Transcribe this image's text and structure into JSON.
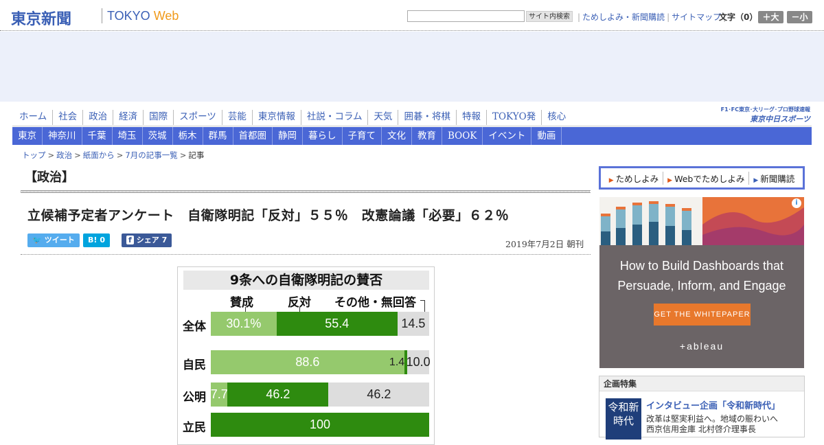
{
  "header": {
    "logo": "東京新聞",
    "logo_en_1": "TOKYO ",
    "logo_en_2": "Web",
    "search_button": "サイト内検索",
    "links": [
      "ためしよみ・新聞購読",
      "サイトマップ"
    ],
    "font_label": "文字（0）",
    "font_larger": "＋大",
    "font_smaller": "－小"
  },
  "nav_main": [
    "ホーム",
    "社会",
    "政治",
    "経済",
    "国際",
    "スポーツ",
    "芸能",
    "東京情報",
    "社説・コラム",
    "天気",
    "囲碁・将棋",
    "特報",
    "TOKYO発",
    "核心"
  ],
  "sports_logo": {
    "top": "F1･FC東京･大リーグ･プロ野球速報",
    "name": "東京中日スポーツ"
  },
  "nav_sub": [
    "東京",
    "神奈川",
    "千葉",
    "埼玉",
    "茨城",
    "栃木",
    "群馬",
    "首都圏",
    "静岡",
    "暮らし",
    "子育て",
    "文化",
    "教育",
    "BOOK",
    "イベント",
    "動画"
  ],
  "breadcrumb": [
    "トップ",
    "政治",
    "紙面から",
    "7月の記事一覧",
    "記事"
  ],
  "breadcrumb_sep": ">",
  "article": {
    "section": "【政治】",
    "headline": "立候補予定者アンケート　自衛隊明記「反対」５５％　改憲論議「必要」６２％",
    "date": "2019年7月2日 朝刊",
    "share": {
      "tweet": "ツイート",
      "hatena_icon": "B!",
      "hatena_count": "0",
      "fb_icon": "f",
      "fb_label": "シェア",
      "fb_count": "7"
    }
  },
  "figure": {
    "title": "9条への自衛隊明記の賛否",
    "legend": [
      "賛成",
      "反対",
      "その他・無回答"
    ],
    "rows": [
      {
        "label": "全体",
        "segments": [
          "30.1%",
          "55.4",
          "14.5"
        ]
      },
      {
        "label": "自民",
        "segments": [
          "88.6",
          "1.4",
          "10.0"
        ]
      },
      {
        "label": "公明",
        "segments": [
          "7.7",
          "46.2",
          "46.2"
        ]
      },
      {
        "label": "立民",
        "segments": [
          "100"
        ]
      }
    ]
  },
  "chart_data": {
    "type": "bar",
    "title": "9条への自衛隊明記の賛否",
    "categories": [
      "全体",
      "自民",
      "公明",
      "立民"
    ],
    "series": [
      {
        "name": "賛成",
        "values": [
          30.1,
          88.6,
          7.7,
          0
        ]
      },
      {
        "name": "反対",
        "values": [
          55.4,
          1.4,
          46.2,
          100
        ]
      },
      {
        "name": "その他・無回答",
        "values": [
          14.5,
          10.0,
          46.2,
          0
        ]
      }
    ],
    "stacked": true,
    "orientation": "horizontal",
    "colors": {
      "賛成": "#95c96d",
      "反対": "#2e8b0f",
      "その他・無回答": "#dddddd"
    }
  },
  "sidebar": {
    "links": [
      "ためしよみ",
      "Webでためしよみ",
      "新聞購読"
    ],
    "ad": {
      "headline": "How to Build Dashboards that Persuade, Inform, and Engage",
      "cta": "GET THE WHITEPAPER",
      "brand": "+ableau",
      "info_icon": "i"
    },
    "feature": {
      "header": "企画特集",
      "image_text": "令和新時代",
      "title": "インタビュー企画「令和新時代」",
      "subtitle_1": "改革は堅実利益へ。地域の賑わいへ",
      "subtitle_2": "西京信用金庫 北村啓介理事長"
    }
  },
  "colors": {
    "brand_blue": "#3a5fb5",
    "nav_bar": "#4a67d6",
    "ad_band": "#ecf0fa",
    "bar_light": "#95c96d",
    "bar_dark": "#2e8b0f",
    "bar_gray": "#dddddd"
  }
}
